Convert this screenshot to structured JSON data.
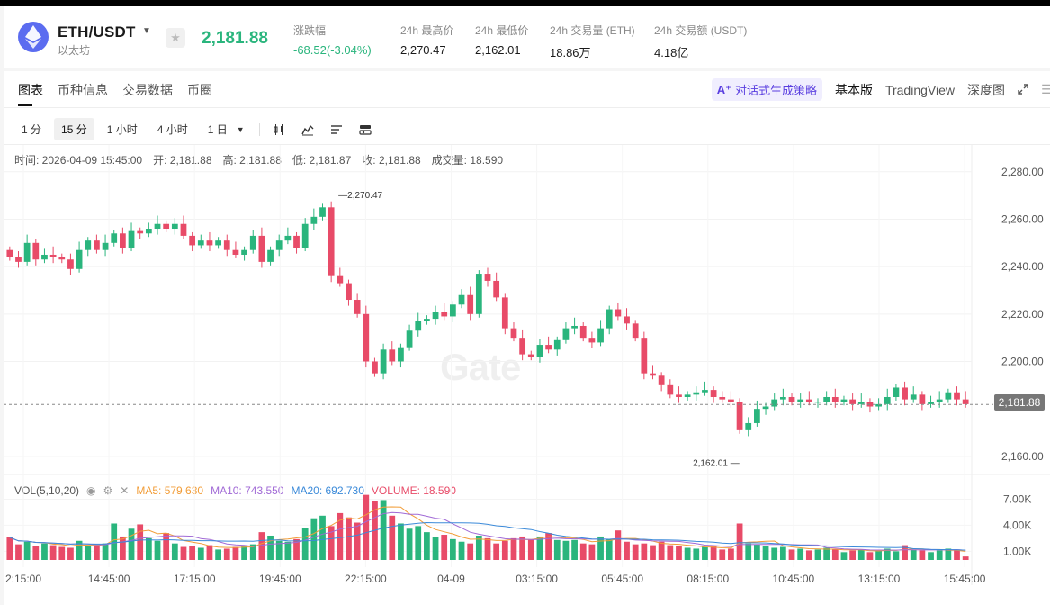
{
  "header": {
    "pair": "ETH/USDT",
    "coin_name": "以太坊",
    "price": "2,181.88",
    "stats": [
      {
        "label": "涨跌幅",
        "value": "-68.52(-3.04%)",
        "green": true
      },
      {
        "label": "24h 最高价",
        "value": "2,270.47"
      },
      {
        "label": "24h 最低价",
        "value": "2,162.01"
      },
      {
        "label": "24h 交易量 (ETH)",
        "value": "18.86万"
      },
      {
        "label": "24h 交易额 (USDT)",
        "value": "4.18亿"
      }
    ]
  },
  "tabs": [
    "图表",
    "币种信息",
    "交易数据",
    "币圈"
  ],
  "right_tabs": {
    "ai": "对话式生成策略",
    "basic": "基本版",
    "tradingview": "TradingView",
    "depth": "深度图"
  },
  "toolbar": {
    "intervals": [
      "1 分",
      "15 分",
      "1 小时",
      "4 小时",
      "1 日"
    ],
    "active_interval": "15 分"
  },
  "infoline": {
    "time": "时间:  2026-04-09 15:45:00",
    "open": "开:  2,181.88",
    "high": "高:  2,181.88",
    "low": "低:  2,181.87",
    "close": "收:  2,181.88",
    "volume": "成交量:  18.590"
  },
  "volume_legend": {
    "title": "VOL(5,10,20)",
    "ma5": "MA5: 579.630",
    "ma10": "MA10: 743.550",
    "ma20": "MA20: 692.730",
    "volume": "VOLUME: 18.590"
  },
  "watermark": "Gate",
  "colors": {
    "up": "#2ab57d",
    "down": "#e84b68",
    "ma5": "#f29d38",
    "ma10": "#a16ad6",
    "ma20": "#3b8ad9"
  },
  "chart_data": {
    "type": "candlestick",
    "price_axis": [
      "2,280.00",
      "2,260.00",
      "2,240.00",
      "2,220.00",
      "2,200.00",
      "2,160.00"
    ],
    "price_range": [
      2155,
      2286
    ],
    "last_price_tag": "2,181.88",
    "high_label": "2,270.47",
    "low_label": "2,162.01",
    "volume_axis": [
      "7.00K",
      "4.00K",
      "1.00K"
    ],
    "volume_range": [
      0,
      8500
    ],
    "time_axis": [
      "2:15:00",
      "14:45:00",
      "17:15:00",
      "19:45:00",
      "22:15:00",
      "04-09",
      "03:15:00",
      "05:45:00",
      "08:15:00",
      "10:45:00",
      "13:15:00",
      "15:45:00"
    ],
    "closes": [
      2244,
      2242,
      2250,
      2243,
      2245,
      2244,
      2243,
      2239,
      2247,
      2251,
      2247,
      2250,
      2254,
      2248,
      2255,
      2254,
      2256,
      2258,
      2256,
      2258,
      2253,
      2249,
      2251,
      2249,
      2251,
      2247,
      2245,
      2247,
      2253,
      2242,
      2247,
      2251,
      2253,
      2248,
      2258,
      2261,
      2265,
      2236,
      2233,
      2226,
      2220,
      2200,
      2195,
      2205,
      2200,
      2206,
      2213,
      2217,
      2218,
      2221,
      2219,
      2224,
      2228,
      2220,
      2237,
      2234,
      2227,
      2214,
      2210,
      2203,
      2202,
      2207,
      2205,
      2209,
      2214,
      2215,
      2210,
      2208,
      2214,
      2222,
      2219,
      2216,
      2210,
      2195,
      2194,
      2190,
      2186,
      2185,
      2186,
      2187,
      2188,
      2185,
      2184,
      2183,
      2171,
      2174,
      2180,
      2181,
      2184,
      2185,
      2183,
      2184,
      2183,
      2183,
      2185,
      2183,
      2184,
      2182,
      2183,
      2181,
      2182,
      2185,
      2189,
      2184,
      2186,
      2182,
      2183,
      2184,
      2187,
      2184,
      2182
    ],
    "volumes": [
      2600,
      1800,
      2100,
      1600,
      1900,
      1700,
      1500,
      1400,
      2200,
      1700,
      1600,
      1900,
      4200,
      2700,
      3600,
      4100,
      2500,
      2200,
      3100,
      1900,
      1500,
      1600,
      1400,
      1700,
      1200,
      1300,
      1500,
      1700,
      1800,
      3200,
      2800,
      2200,
      2100,
      2400,
      3700,
      4800,
      5100,
      3900,
      5400,
      4900,
      4300,
      7500,
      6800,
      6900,
      5100,
      4200,
      3600,
      3900,
      3200,
      2600,
      2900,
      2400,
      2100,
      1900,
      2800,
      2500,
      1900,
      2200,
      2500,
      2700,
      2400,
      2700,
      3100,
      2300,
      2200,
      2300,
      1900,
      1800,
      2700,
      2400,
      3400,
      2100,
      1800,
      1900,
      1700,
      2100,
      1700,
      1600,
      1400,
      1300,
      1500,
      1600,
      1200,
      1300,
      4200,
      1900,
      1800,
      1600,
      1400,
      1500,
      1200,
      1300,
      1100,
      1200,
      1400,
      1200,
      900,
      1100,
      1200,
      900,
      1100,
      1300,
      1000,
      1700,
      1200,
      1100,
      900,
      1100,
      1300,
      1200,
      400
    ]
  }
}
